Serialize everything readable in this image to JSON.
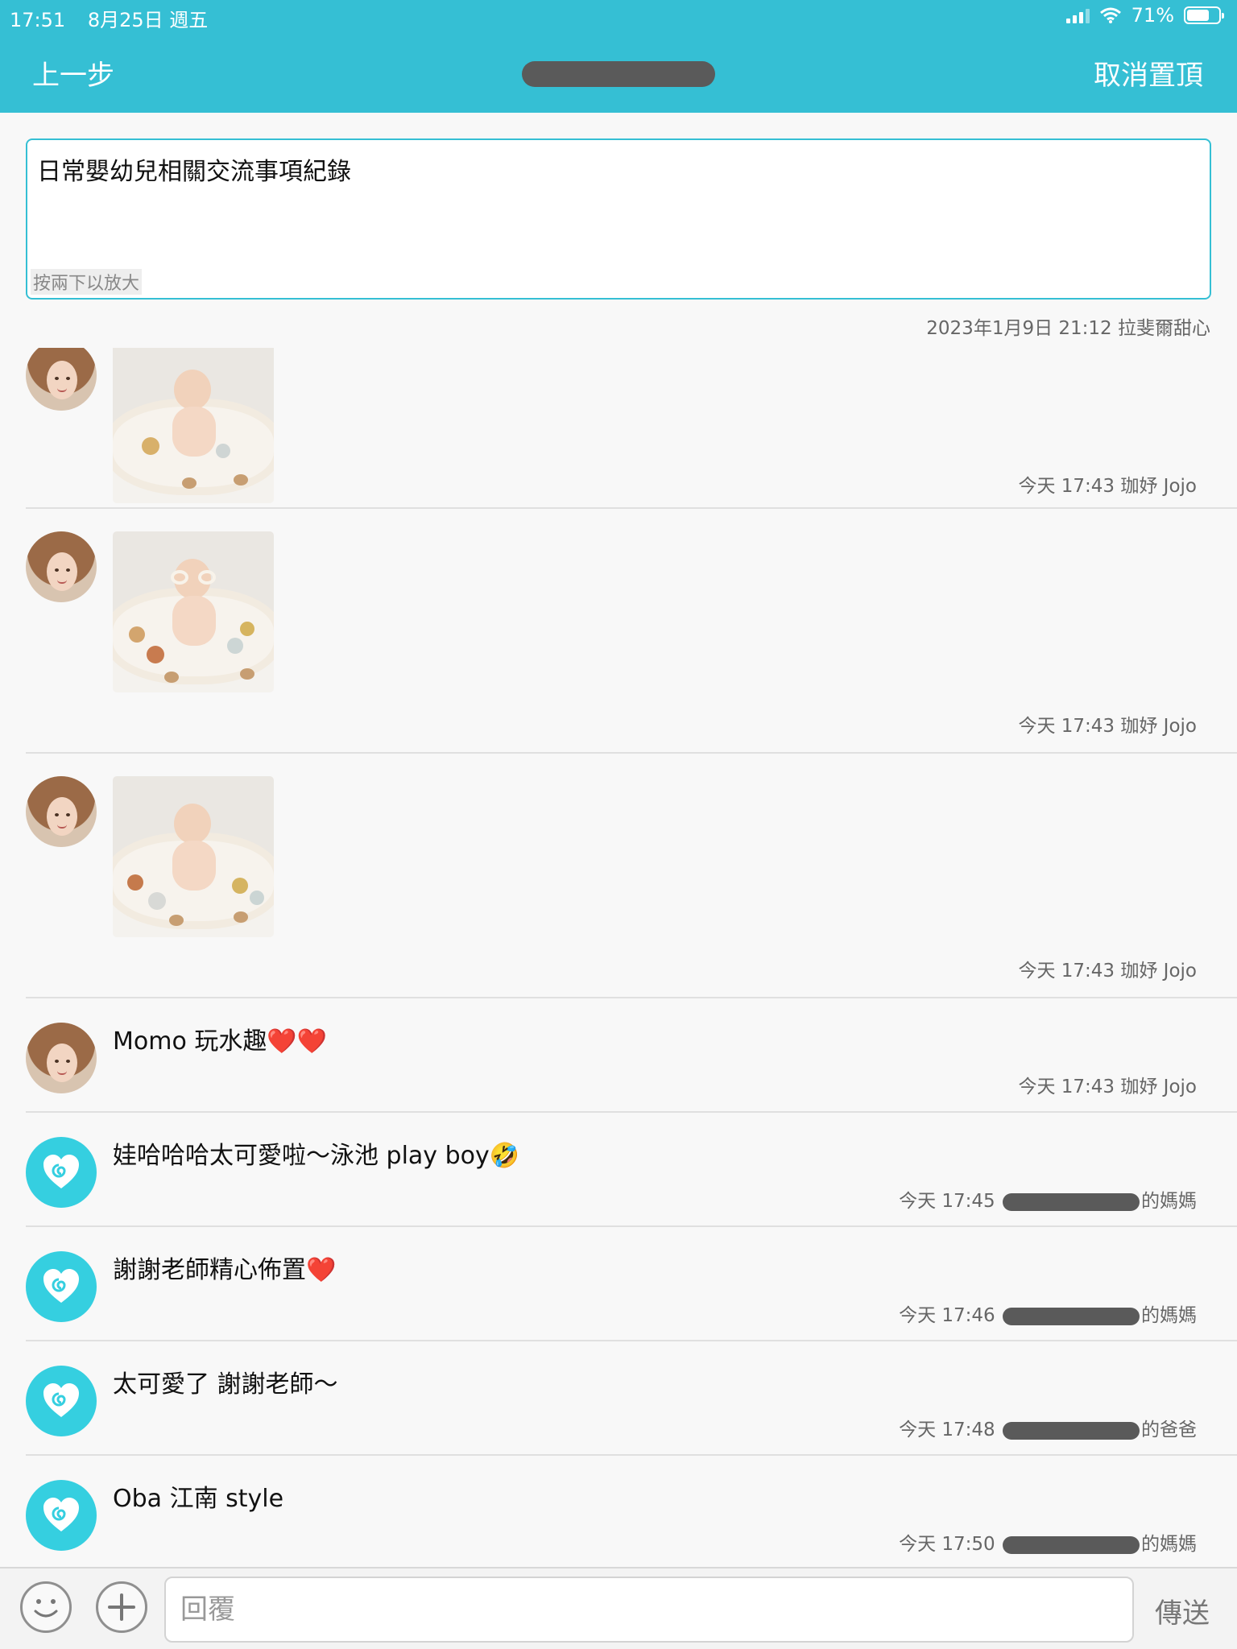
{
  "status_bar": {
    "time": "17:51",
    "date": "8月25日 週五",
    "battery": "71%",
    "battery_level": 0.71
  },
  "header": {
    "back_label": "上一步",
    "title": "",
    "action_label": "取消置頂",
    "background_color": "#35bfd4"
  },
  "pinned_note": {
    "text": "日常嬰幼兒相關交流事項紀錄",
    "hint": "按兩下以放大",
    "meta": "2023年1月9日 21:12 拉斐爾甜心"
  },
  "messages": [
    {
      "type": "image",
      "avatar": "teacher-photo",
      "meta": "今天 17:43 珈妤 Jojo"
    },
    {
      "type": "image",
      "avatar": "teacher-photo",
      "meta": "今天 17:43 珈妤 Jojo"
    },
    {
      "type": "image",
      "avatar": "teacher-photo",
      "meta": "今天 17:43 珈妤 Jojo"
    },
    {
      "type": "text",
      "avatar": "teacher-photo",
      "text": "Momo 玩水趣❤️❤️",
      "meta": "今天 17:43 珈妤 Jojo"
    },
    {
      "type": "text",
      "avatar": "app-heart-icon",
      "text": "娃哈哈哈太可愛啦～泳池 play boy🤣",
      "meta_time": "今天 17:45",
      "meta_suffix": "的媽媽"
    },
    {
      "type": "text",
      "avatar": "app-heart-icon",
      "text": "謝謝老師精心佈置❤️",
      "meta_time": "今天 17:46",
      "meta_suffix": "的媽媽"
    },
    {
      "type": "text",
      "avatar": "app-heart-icon",
      "text": "太可愛了 謝謝老師～",
      "meta_time": "今天 17:48",
      "meta_suffix": "的爸爸"
    },
    {
      "type": "text",
      "avatar": "app-heart-icon",
      "text": "Oba 江南 style",
      "meta_time": "今天 17:50",
      "meta_suffix": "的媽媽"
    }
  ],
  "composer": {
    "placeholder": "回覆",
    "send_label": "傳送",
    "emoji_icon": "smiley-icon",
    "add_icon": "plus-icon"
  }
}
